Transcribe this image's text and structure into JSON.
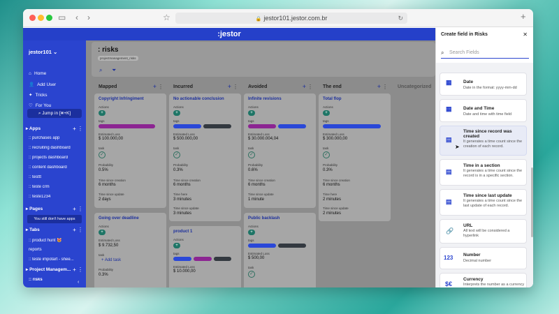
{
  "browser": {
    "url": "jestor101.jestor.com.br"
  },
  "app": {
    "logo": ":jestor"
  },
  "sidebar": {
    "workspace": "jestor101",
    "nav": [
      {
        "label": "Home",
        "icon": "home-icon"
      },
      {
        "label": "Add User",
        "icon": "add-user-icon"
      },
      {
        "label": "Tricks",
        "icon": "tricks-icon"
      },
      {
        "label": "For You",
        "icon": "heart-icon"
      }
    ],
    "jump": "Jump in [⌘+K]",
    "apps_title": "Apps",
    "apps": [
      ":: purchases app",
      ":: recruiting dashboard",
      ":: projects dashboard",
      ":: content dashboard",
      ":: testtt",
      ":: teste crm",
      ":: teste1234"
    ],
    "pages_title": "Pages",
    "pages_note": "You still don't have apps",
    "tabs_title": "Tabs",
    "tabs": [
      ":: product hunt 😻",
      "reports",
      ":: teste impotart - shee..."
    ],
    "project_title": "Project Managem...",
    "project_items": [
      ":: risks"
    ]
  },
  "page": {
    "title": ": risks",
    "tag": "projectmanagement_risks"
  },
  "columns": [
    {
      "title": "Mapped"
    },
    {
      "title": "Incurred"
    },
    {
      "title": "Avoided"
    },
    {
      "title": "The end"
    },
    {
      "title": "Uncategorized"
    }
  ],
  "labels": {
    "actions": "Actions",
    "tags": "tags",
    "estimated_loss": "Estimated Loss",
    "task": "task",
    "probability": "Probability",
    "time_since_creation": "Time since creation",
    "time_since_update": "Time since update",
    "time_here": "Time here",
    "add_task": "+ Add task"
  },
  "cards": {
    "mapped_1": {
      "title": "Copyright Infringiment",
      "loss": "$ 100.000,00",
      "probability": "0.5%",
      "creation": "6 months",
      "update": "2 days"
    },
    "mapped_2": {
      "title": "Going over deadline",
      "loss": "$ 9.732,50",
      "probability": "0.3%"
    },
    "incurred_1": {
      "title": "No actionable conclusion",
      "loss": "$ 500.000,00",
      "probability": "0.3%",
      "creation": "6 months",
      "here": "3 minutes",
      "update": "3 minutes"
    },
    "incurred_2": {
      "title": "product 1",
      "loss": "$ 10.000,00"
    },
    "avoided_1": {
      "title": "Infinite revisions",
      "loss": "$ 30.000.004,04",
      "probability": "0.6%",
      "creation": "6 months",
      "update": "1 minute"
    },
    "avoided_2": {
      "title": "Public backlash",
      "loss": "$ 500,00"
    },
    "end_1": {
      "title": "Total flop",
      "loss": "$ 300.000,00",
      "probability": "0.3%",
      "creation": "6 months",
      "here": "2 minutes",
      "update": "2 minutes"
    }
  },
  "panel": {
    "title": "Create field in Risks",
    "search_placeholder": "Search Fields",
    "fields": [
      {
        "name": "Date",
        "desc": "Date in the format: yyyy-mm-dd",
        "icon": "calendar-icon",
        "glyph": "▦"
      },
      {
        "name": "Date and Time",
        "desc": "Date and time with time field",
        "icon": "calendar-clock-icon",
        "glyph": "▦"
      },
      {
        "name": "Time since record was created",
        "desc": "It generates a time count since the creation of each record.",
        "icon": "time-since-created-icon",
        "glyph": "▤"
      },
      {
        "name": "Time in a section",
        "desc": "It generates a time count since the record is in a specific section.",
        "icon": "time-in-section-icon",
        "glyph": "▤"
      },
      {
        "name": "Time since last update",
        "desc": "It generates a time count since the last update of each record.",
        "icon": "time-since-update-icon",
        "glyph": "▤"
      },
      {
        "name": "URL",
        "desc": "All text will be considered a hyperlink",
        "icon": "link-icon",
        "glyph": "🔗"
      },
      {
        "name": "Number",
        "desc": "Decimal number",
        "icon": "number-icon",
        "glyph": "123"
      },
      {
        "name": "Currency",
        "desc": "Interprets the number as a currency",
        "icon": "currency-icon",
        "glyph": "$€"
      }
    ]
  },
  "colors": {
    "brand": "#2a44cf",
    "tag_purple": "#8c2592",
    "tag_blue": "#2a48d8",
    "tag_dark": "#333940"
  }
}
